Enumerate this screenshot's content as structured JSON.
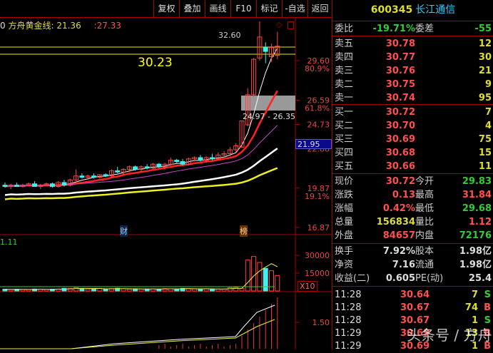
{
  "toolbar": {
    "buttons": [
      "复权",
      "叠加",
      "画线",
      "F10",
      "标记",
      "-自选",
      "返回"
    ]
  },
  "indicator": {
    "name": "方舟黄金线:",
    "value1": "21.36",
    "value2": ":27.33",
    "prefix": "0"
  },
  "price_labels": {
    "high_mark": "32.60",
    "big_price": "30.23",
    "range": "24.97 - 26.35",
    "current": "21.95"
  },
  "axis": {
    "price": [
      {
        "v": "29.60",
        "p": "80.9%"
      },
      {
        "v": "26.59",
        "p": "61.8%"
      },
      {
        "v": "24.73",
        "p": ""
      },
      {
        "v": "22.88",
        "p": ""
      },
      {
        "v": "19.87",
        "p": "19.1%"
      },
      {
        "v": "16.87",
        "p": ""
      }
    ],
    "volume": [
      "30000",
      "15000"
    ],
    "vol_unit": "X10",
    "lower": "1.50",
    "vol_left": "1.11"
  },
  "markers": {
    "cai": "财",
    "bang": "榜"
  },
  "chart_data": {
    "type": "candlestick",
    "candles": [
      [
        20.1,
        20.3,
        19.9,
        20.0
      ],
      [
        20.0,
        20.2,
        19.8,
        20.1
      ],
      [
        20.1,
        20.3,
        20.0,
        20.0
      ],
      [
        20.0,
        20.2,
        19.9,
        20.1
      ],
      [
        20.1,
        20.3,
        20.0,
        20.2
      ],
      [
        20.2,
        20.4,
        20.0,
        20.0
      ],
      [
        20.0,
        20.2,
        19.8,
        20.1
      ],
      [
        20.1,
        20.3,
        20.0,
        20.2
      ],
      [
        20.2,
        20.3,
        19.9,
        20.0
      ],
      [
        20.0,
        20.4,
        19.9,
        20.3
      ],
      [
        20.3,
        20.5,
        20.0,
        20.1
      ],
      [
        20.1,
        20.6,
        20.0,
        20.5
      ],
      [
        20.5,
        21.3,
        20.4,
        20.8
      ],
      [
        20.8,
        21.0,
        20.6,
        20.7
      ],
      [
        20.7,
        20.9,
        20.5,
        20.8
      ],
      [
        20.8,
        21.0,
        20.6,
        20.7
      ],
      [
        20.7,
        20.9,
        20.6,
        20.9
      ],
      [
        20.9,
        21.0,
        20.7,
        20.8
      ],
      [
        20.8,
        21.3,
        20.7,
        21.2
      ],
      [
        21.2,
        21.5,
        21.0,
        21.1
      ],
      [
        21.1,
        21.4,
        20.9,
        21.3
      ],
      [
        21.3,
        21.6,
        21.1,
        21.5
      ],
      [
        21.5,
        21.6,
        21.2,
        21.3
      ],
      [
        21.3,
        21.6,
        21.1,
        21.5
      ],
      [
        21.5,
        21.7,
        21.3,
        21.4
      ],
      [
        21.4,
        21.8,
        21.3,
        21.7
      ],
      [
        21.7,
        21.8,
        21.4,
        21.5
      ],
      [
        21.5,
        21.8,
        21.3,
        21.7
      ],
      [
        21.7,
        22.2,
        21.6,
        22.0
      ],
      [
        22.0,
        22.1,
        21.8,
        21.9
      ],
      [
        21.9,
        22.1,
        21.6,
        21.7
      ],
      [
        21.7,
        22.2,
        21.6,
        22.1
      ],
      [
        22.1,
        22.3,
        21.9,
        22.2
      ],
      [
        22.2,
        22.4,
        21.9,
        22.0
      ],
      [
        22.0,
        22.3,
        21.8,
        22.2
      ],
      [
        22.2,
        22.5,
        22.0,
        22.1
      ],
      [
        22.1,
        22.6,
        22.0,
        22.4
      ],
      [
        22.4,
        22.7,
        22.2,
        22.5
      ],
      [
        22.5,
        23.0,
        22.3,
        22.8
      ],
      [
        22.8,
        23.3,
        22.6,
        23.1
      ],
      [
        23.0,
        25.0,
        23.0,
        25.0
      ],
      [
        24.7,
        27.5,
        24.6,
        27.0
      ],
      [
        27.0,
        29.8,
        26.8,
        29.7
      ],
      [
        29.8,
        32.6,
        29.6,
        31.4
      ],
      [
        30.6,
        31.0,
        29.4,
        30.3
      ],
      [
        29.9,
        30.9,
        29.5,
        30.6
      ],
      [
        30.0,
        31.8,
        29.7,
        30.7
      ]
    ],
    "volumes": [
      1500,
      1200,
      1500,
      1300,
      1200,
      1600,
      1500,
      1300,
      1500,
      1600,
      2200,
      2200,
      2800,
      2000,
      1600,
      1900,
      2100,
      1500,
      2000,
      2300,
      1800,
      1500,
      1600,
      1600,
      1700,
      1800,
      1600,
      2000,
      1800,
      1600,
      2200,
      2000,
      1700,
      1600,
      1700,
      1800,
      1600,
      1600,
      2800,
      3000,
      2200,
      26000,
      29000,
      24000,
      19000,
      17000,
      13000
    ]
  },
  "quote": {
    "code": "600345",
    "name": "长江通信",
    "ratio": {
      "label": "委比",
      "value": "-19.71%",
      "label2": "委差",
      "value2": "-55"
    },
    "sells": [
      {
        "label": "卖五",
        "price": "30.78",
        "vol": "12"
      },
      {
        "label": "卖四",
        "price": "30.77",
        "vol": "30"
      },
      {
        "label": "卖三",
        "price": "30.76",
        "vol": "21"
      },
      {
        "label": "卖二",
        "price": "30.75",
        "vol": "9"
      },
      {
        "label": "卖一",
        "price": "30.74",
        "vol": "95"
      }
    ],
    "buys": [
      {
        "label": "买一",
        "price": "30.72",
        "vol": "7"
      },
      {
        "label": "买二",
        "price": "30.70",
        "vol": "4"
      },
      {
        "label": "买三",
        "price": "30.69",
        "vol": "75"
      },
      {
        "label": "买四",
        "price": "30.68",
        "vol": "15"
      },
      {
        "label": "买五",
        "price": "30.66",
        "vol": "11"
      }
    ],
    "stats": [
      {
        "l1": "现价",
        "v1": "30.72",
        "c1": "red",
        "l2": "今开",
        "v2": "29.83",
        "c2": "green"
      },
      {
        "l1": "涨跌",
        "v1": "0.13",
        "c1": "red",
        "l2": "最高",
        "v2": "31.84",
        "c2": "red"
      },
      {
        "l1": "涨幅",
        "v1": "0.42%",
        "c1": "red",
        "l2": "最低",
        "v2": "29.68",
        "c2": "green"
      },
      {
        "l1": "总量",
        "v1": "156834",
        "c1": "yellow",
        "l2": "量比",
        "v2": "1.12",
        "c2": "red"
      },
      {
        "l1": "外盘",
        "v1": "84657",
        "c1": "red",
        "l2": "内盘",
        "v2": "72176",
        "c2": "green"
      }
    ],
    "fund": [
      {
        "l1": "换手",
        "v1": "7.92%",
        "l2": "股本",
        "v2": "1.98亿"
      },
      {
        "l1": "净资",
        "v1": "7.16",
        "l2": "流通",
        "v2": "1.98亿"
      },
      {
        "l1": "收益(二)",
        "v1": "0.605",
        "l2": "PE(动)",
        "v2": "25.4"
      }
    ],
    "ticks": [
      {
        "time": "11:28",
        "price": "30.64",
        "vol": "7",
        "side": "S"
      },
      {
        "time": "11:28",
        "price": "30.67",
        "vol": "74",
        "side": "B"
      },
      {
        "time": "11:28",
        "price": "30.67",
        "vol": "1",
        "side": "S"
      },
      {
        "time": "11:29",
        "price": "30.69",
        "vol": "13",
        "side": "B"
      },
      {
        "time": "11:29",
        "price": "30.69",
        "vol": "1",
        "side": "B"
      }
    ]
  },
  "watermark": "头条号 / 方舟"
}
